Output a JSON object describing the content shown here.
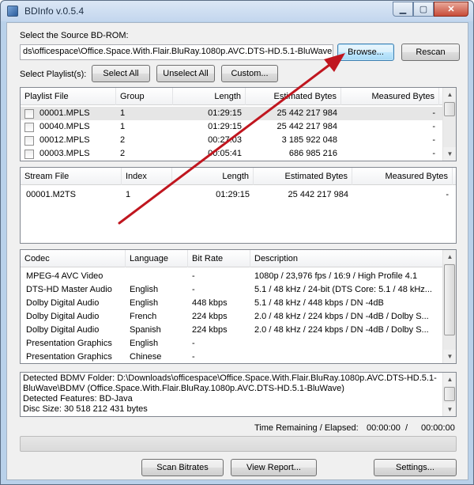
{
  "window": {
    "title": "BDInfo v.0.5.4",
    "min_label": "▁",
    "max_label": "▢",
    "close_label": "✕"
  },
  "source": {
    "label": "Select the Source BD-ROM:",
    "path": "ds\\officespace\\Office.Space.With.Flair.BluRay.1080p.AVC.DTS-HD.5.1-BluWave",
    "browse_label": "Browse...",
    "rescan_label": "Rescan"
  },
  "playlist_controls": {
    "label": "Select Playlist(s):",
    "select_all": "Select All",
    "unselect_all": "Unselect All",
    "custom": "Custom..."
  },
  "playlists": {
    "headers": [
      "Playlist File",
      "Group",
      "Length",
      "Estimated Bytes",
      "Measured Bytes"
    ],
    "rows": [
      [
        "00001.MPLS",
        "1",
        "01:29:15",
        "25 442 217 984",
        "-"
      ],
      [
        "00040.MPLS",
        "1",
        "01:29:15",
        "25 442 217 984",
        "-"
      ],
      [
        "00012.MPLS",
        "2",
        "00:27:03",
        "3 185 922 048",
        "-"
      ],
      [
        "00003.MPLS",
        "2",
        "00:05:41",
        "686 985 216",
        "-"
      ]
    ]
  },
  "streams": {
    "headers": [
      "Stream File",
      "Index",
      "Length",
      "Estimated Bytes",
      "Measured Bytes"
    ],
    "rows": [
      [
        "00001.M2TS",
        "1",
        "01:29:15",
        "25 442 217 984",
        "-"
      ]
    ]
  },
  "codecs": {
    "headers": [
      "Codec",
      "Language",
      "Bit Rate",
      "Description"
    ],
    "rows": [
      [
        "MPEG-4 AVC Video",
        "",
        "-",
        "1080p / 23,976 fps / 16:9 / High Profile 4.1"
      ],
      [
        "DTS-HD Master Audio",
        "English",
        "-",
        "5.1 / 48 kHz / 24-bit (DTS Core: 5.1 / 48 kHz..."
      ],
      [
        "Dolby Digital Audio",
        "English",
        "448 kbps",
        "5.1 / 48 kHz / 448 kbps / DN -4dB"
      ],
      [
        "Dolby Digital Audio",
        "French",
        "224 kbps",
        "2.0 / 48 kHz / 224 kbps / DN -4dB / Dolby S..."
      ],
      [
        "Dolby Digital Audio",
        "Spanish",
        "224 kbps",
        "2.0 / 48 kHz / 224 kbps / DN -4dB / Dolby S..."
      ],
      [
        "Presentation Graphics",
        "English",
        "-",
        ""
      ],
      [
        "Presentation Graphics",
        "Chinese",
        "-",
        ""
      ]
    ]
  },
  "info": {
    "lines": [
      "Detected BDMV Folder: D:\\Downloads\\officespace\\Office.Space.With.Flair.BluRay.1080p.AVC.DTS-HD.5.1-",
      "BluWave\\BDMV (Office.Space.With.Flair.BluRay.1080p.AVC.DTS-HD.5.1-BluWave)",
      "Detected Features: BD-Java",
      "Disc Size: 30 518 212 431 bytes"
    ]
  },
  "time": {
    "label": "Time Remaining / Elapsed:",
    "remaining": "00:00:00",
    "separator": "/",
    "elapsed": "00:00:00"
  },
  "progress": {
    "value": 0
  },
  "bottom_buttons": {
    "scan_bitrates": "Scan Bitrates",
    "view_report": "View Report...",
    "settings": "Settings..."
  },
  "annotation": {
    "color": "#c0161f",
    "shape": "arrow"
  }
}
